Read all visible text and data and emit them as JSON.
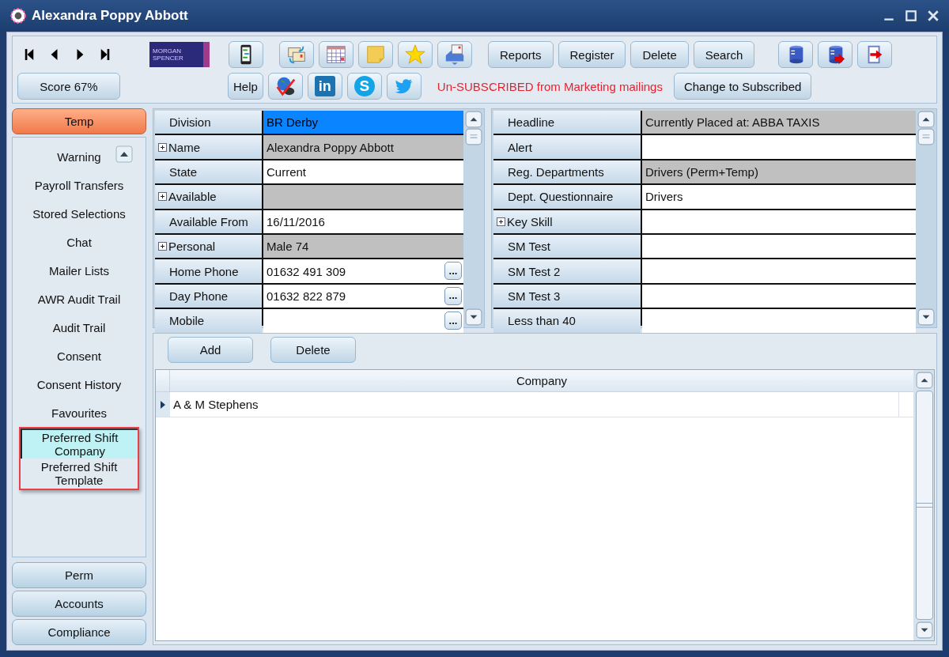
{
  "window": {
    "title": "Alexandra Poppy Abbott"
  },
  "toolbar": {
    "logo": [
      "MORGAN",
      "SPENCER"
    ],
    "nav": [
      {
        "kind": "first"
      },
      {
        "kind": "prev"
      },
      {
        "kind": "next"
      },
      {
        "kind": "last"
      }
    ],
    "icons_top": [
      {
        "kind": "chat"
      },
      {
        "kind": "mail-swap"
      },
      {
        "kind": "calendar"
      },
      {
        "kind": "note"
      },
      {
        "kind": "star"
      },
      {
        "kind": "mail-stack"
      }
    ],
    "buttons_top": [
      "Reports",
      "Register",
      "Delete",
      "Search"
    ],
    "icons_right": [
      {
        "kind": "db-sync"
      },
      {
        "kind": "db-export"
      },
      {
        "kind": "exit"
      }
    ],
    "score": "Score 67%",
    "help": "Help",
    "icons_bottom": [
      {
        "kind": "web-check"
      },
      {
        "kind": "linkedin",
        "glyph": "in"
      },
      {
        "kind": "skype",
        "glyph": "S"
      },
      {
        "kind": "twitter"
      }
    ],
    "subscription_notice": "Un-SUBSCRIBED from Marketing mailings",
    "subscribe_button": "Change to Subscribed"
  },
  "sidebar": {
    "groups_top": [
      {
        "label": "Temp",
        "selected": true
      }
    ],
    "items": [
      {
        "label": "Warning",
        "selected": false,
        "highlighted": false
      },
      {
        "label": "Payroll Transfers",
        "selected": false,
        "highlighted": false
      },
      {
        "label": "Stored Selections",
        "selected": false,
        "highlighted": false
      },
      {
        "label": "Chat",
        "selected": false,
        "highlighted": false
      },
      {
        "label": "Mailer Lists",
        "selected": false,
        "highlighted": false
      },
      {
        "label": "AWR Audit Trail",
        "selected": false,
        "highlighted": false
      },
      {
        "label": "Audit Trail",
        "selected": false,
        "highlighted": false
      },
      {
        "label": "Consent",
        "selected": false,
        "highlighted": false
      },
      {
        "label": "Consent History",
        "selected": false,
        "highlighted": false
      },
      {
        "label": "Favourites",
        "selected": false,
        "highlighted": false
      },
      {
        "label": "Preferred Shift Company",
        "selected": true,
        "highlighted": true
      },
      {
        "label": "Preferred Shift Template",
        "selected": false,
        "highlighted": true
      }
    ],
    "groups_bottom": [
      {
        "label": "Perm",
        "selected": false
      },
      {
        "label": "Accounts",
        "selected": false
      },
      {
        "label": "Compliance",
        "selected": false
      }
    ]
  },
  "fields_left": [
    {
      "label": "Division",
      "value": "BR Derby",
      "expandable": false,
      "shaded": false,
      "selected": true,
      "has_button": false
    },
    {
      "label": "Name",
      "value": "Alexandra Poppy Abbott",
      "expandable": true,
      "shaded": true,
      "selected": false,
      "has_button": false
    },
    {
      "label": "State",
      "value": "Current",
      "expandable": false,
      "shaded": false,
      "selected": false,
      "has_button": false
    },
    {
      "label": "Available",
      "expandable": true,
      "shaded": true,
      "selected": false,
      "has_button": false
    },
    {
      "label": "Available From",
      "value": "16/11/2016",
      "expandable": false,
      "shaded": false,
      "selected": false,
      "has_button": false
    },
    {
      "label": "Personal",
      "value": "Male 74",
      "expandable": true,
      "shaded": true,
      "selected": false,
      "has_button": false
    },
    {
      "label": "Home Phone",
      "value": "01632 491 309",
      "expandable": false,
      "shaded": false,
      "selected": false,
      "has_button": true,
      "button": "..."
    },
    {
      "label": "Day Phone",
      "value": "01632 822 879",
      "expandable": false,
      "shaded": false,
      "selected": false,
      "has_button": true,
      "button": "..."
    },
    {
      "label": "Mobile",
      "expandable": false,
      "shaded": false,
      "selected": false,
      "has_button": true,
      "button": "..."
    }
  ],
  "fields_right": [
    {
      "label": "Headline",
      "value": "Currently Placed at: ABBA TAXIS",
      "expandable": false,
      "shaded": true,
      "selected": false,
      "has_button": false
    },
    {
      "label": "Alert",
      "expandable": false,
      "shaded": false,
      "selected": false,
      "has_button": false
    },
    {
      "label": "Reg. Departments",
      "value": "Drivers (Perm+Temp)",
      "expandable": false,
      "shaded": true,
      "selected": false,
      "has_button": false
    },
    {
      "label": "Dept. Questionnaire",
      "value": "Drivers",
      "expandable": false,
      "shaded": false,
      "selected": false,
      "has_button": false
    },
    {
      "label": "Key Skill",
      "expandable": true,
      "shaded": false,
      "selected": false,
      "has_button": false
    },
    {
      "label": "SM Test",
      "expandable": false,
      "shaded": false,
      "selected": false,
      "has_button": false
    },
    {
      "label": "SM Test 2",
      "expandable": false,
      "shaded": false,
      "selected": false,
      "has_button": false
    },
    {
      "label": "SM Test 3",
      "expandable": false,
      "shaded": false,
      "selected": false,
      "has_button": false
    },
    {
      "label": "Less than 40",
      "expandable": false,
      "shaded": false,
      "selected": false,
      "has_button": false
    }
  ],
  "list": {
    "buttons": [
      "Add",
      "Delete"
    ],
    "columns": [
      "Company"
    ],
    "rows": [
      {
        "cells": [
          "A & M Stephens"
        ],
        "selected": true
      }
    ]
  }
}
